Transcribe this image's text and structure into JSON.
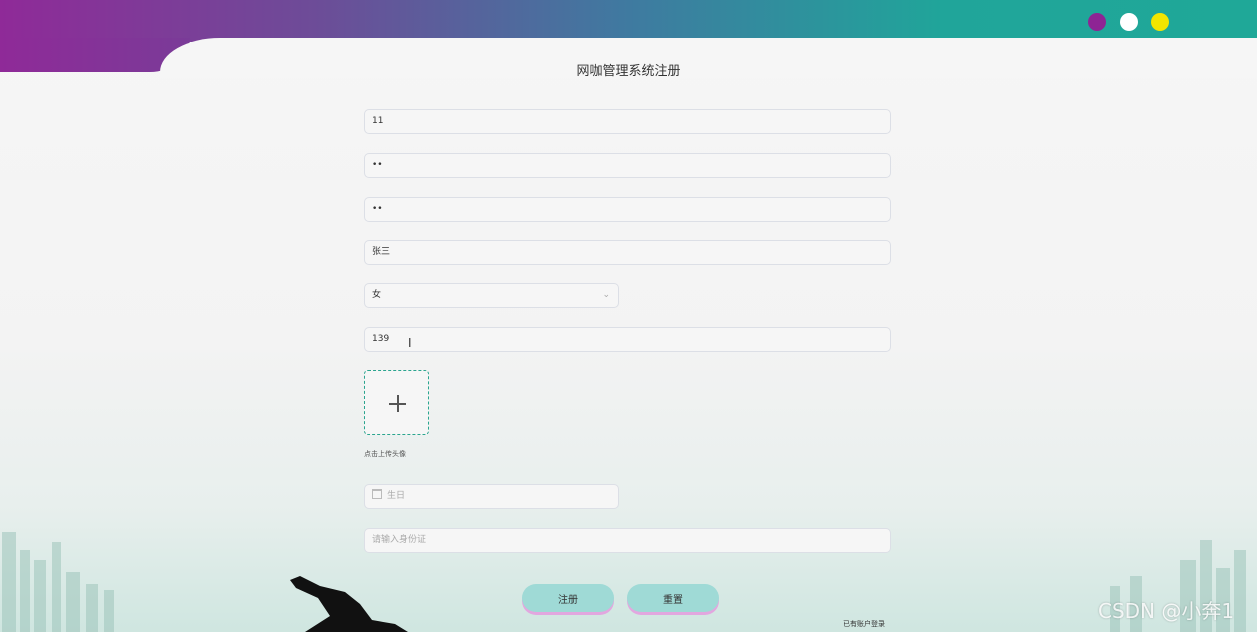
{
  "page": {
    "title": "网咖管理系统注册"
  },
  "form": {
    "account": {
      "value": "11"
    },
    "password": {
      "value": "••"
    },
    "confirm_password": {
      "value": "••"
    },
    "name": {
      "value": "张三"
    },
    "gender": {
      "value": "女"
    },
    "phone": {
      "value": "139"
    },
    "avatar": {
      "tip": "点击上传头像"
    },
    "birthday": {
      "placeholder": "生日"
    },
    "id_card": {
      "placeholder": "请输入身份证"
    }
  },
  "buttons": {
    "register": "注册",
    "reset": "重置"
  },
  "login_link": "已有账户登录",
  "watermark": "CSDN @小奔1",
  "colors": {
    "header_start": "#8f2a98",
    "header_end": "#1fa898",
    "dot_purple": "#8e2494",
    "dot_white": "#ffffff",
    "dot_yellow": "#f2e500",
    "button_bg": "#9fdad6",
    "upload_border": "#2ba58f"
  }
}
